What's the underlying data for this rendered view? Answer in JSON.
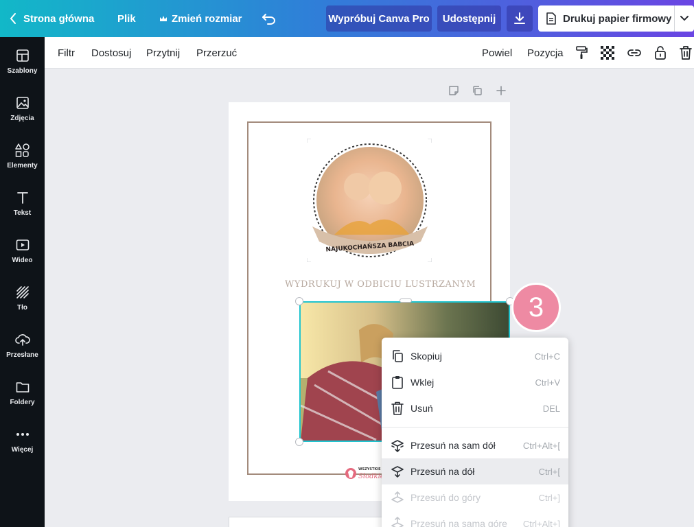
{
  "topbar": {
    "home": "Strona główna",
    "file": "Plik",
    "resize": "Zmień rozmiar",
    "try_pro": "Wypróbuj Canva Pro",
    "share": "Udostępnij",
    "print": "Drukuj papier firmowy",
    "colors": {
      "gradient_start": "#12b8c8",
      "gradient_end": "#6a45e3"
    }
  },
  "sidebar": {
    "items": [
      {
        "label": "Szablony",
        "icon": "templates-icon"
      },
      {
        "label": "Zdjęcia",
        "icon": "photos-icon"
      },
      {
        "label": "Elementy",
        "icon": "elements-icon"
      },
      {
        "label": "Tekst",
        "icon": "text-icon"
      },
      {
        "label": "Wideo",
        "icon": "video-icon"
      },
      {
        "label": "Tło",
        "icon": "background-icon"
      },
      {
        "label": "Przesłane",
        "icon": "upload-icon"
      },
      {
        "label": "Foldery",
        "icon": "folder-icon"
      },
      {
        "label": "Więcej",
        "icon": "more-icon"
      }
    ]
  },
  "toolbar": {
    "filter": "Filtr",
    "adjust": "Dostosuj",
    "crop": "Przytnij",
    "flip": "Przerzuć",
    "animate": "Powiel",
    "position": "Pozycja"
  },
  "canvas": {
    "mirror_text": "WYDRUKUJ W ODBICIU LUSTRZANYM",
    "badge_text": "NAJUKOCHAŃSZA BABCIA",
    "logo_text": "WSZYSTKIE",
    "logo_script": "Słodkie",
    "step_number": "3"
  },
  "context_menu": {
    "items": [
      {
        "label": "Skopiuj",
        "shortcut": "Ctrl+C",
        "icon": "copy-icon"
      },
      {
        "label": "Wklej",
        "shortcut": "Ctrl+V",
        "icon": "paste-icon"
      },
      {
        "label": "Usuń",
        "shortcut": "DEL",
        "icon": "trash-icon"
      },
      {
        "label": "Przesuń na sam dół",
        "shortcut": "Ctrl+Alt+[",
        "icon": "send-to-back-icon"
      },
      {
        "label": "Przesuń na dół",
        "shortcut": "Ctrl+[",
        "icon": "send-backward-icon"
      },
      {
        "label": "Przesuń do góry",
        "shortcut": "Ctrl+]",
        "icon": "bring-forward-icon"
      },
      {
        "label": "Przesuń na samą górę",
        "shortcut": "Ctrl+Alt+]",
        "icon": "bring-to-front-icon"
      }
    ]
  }
}
